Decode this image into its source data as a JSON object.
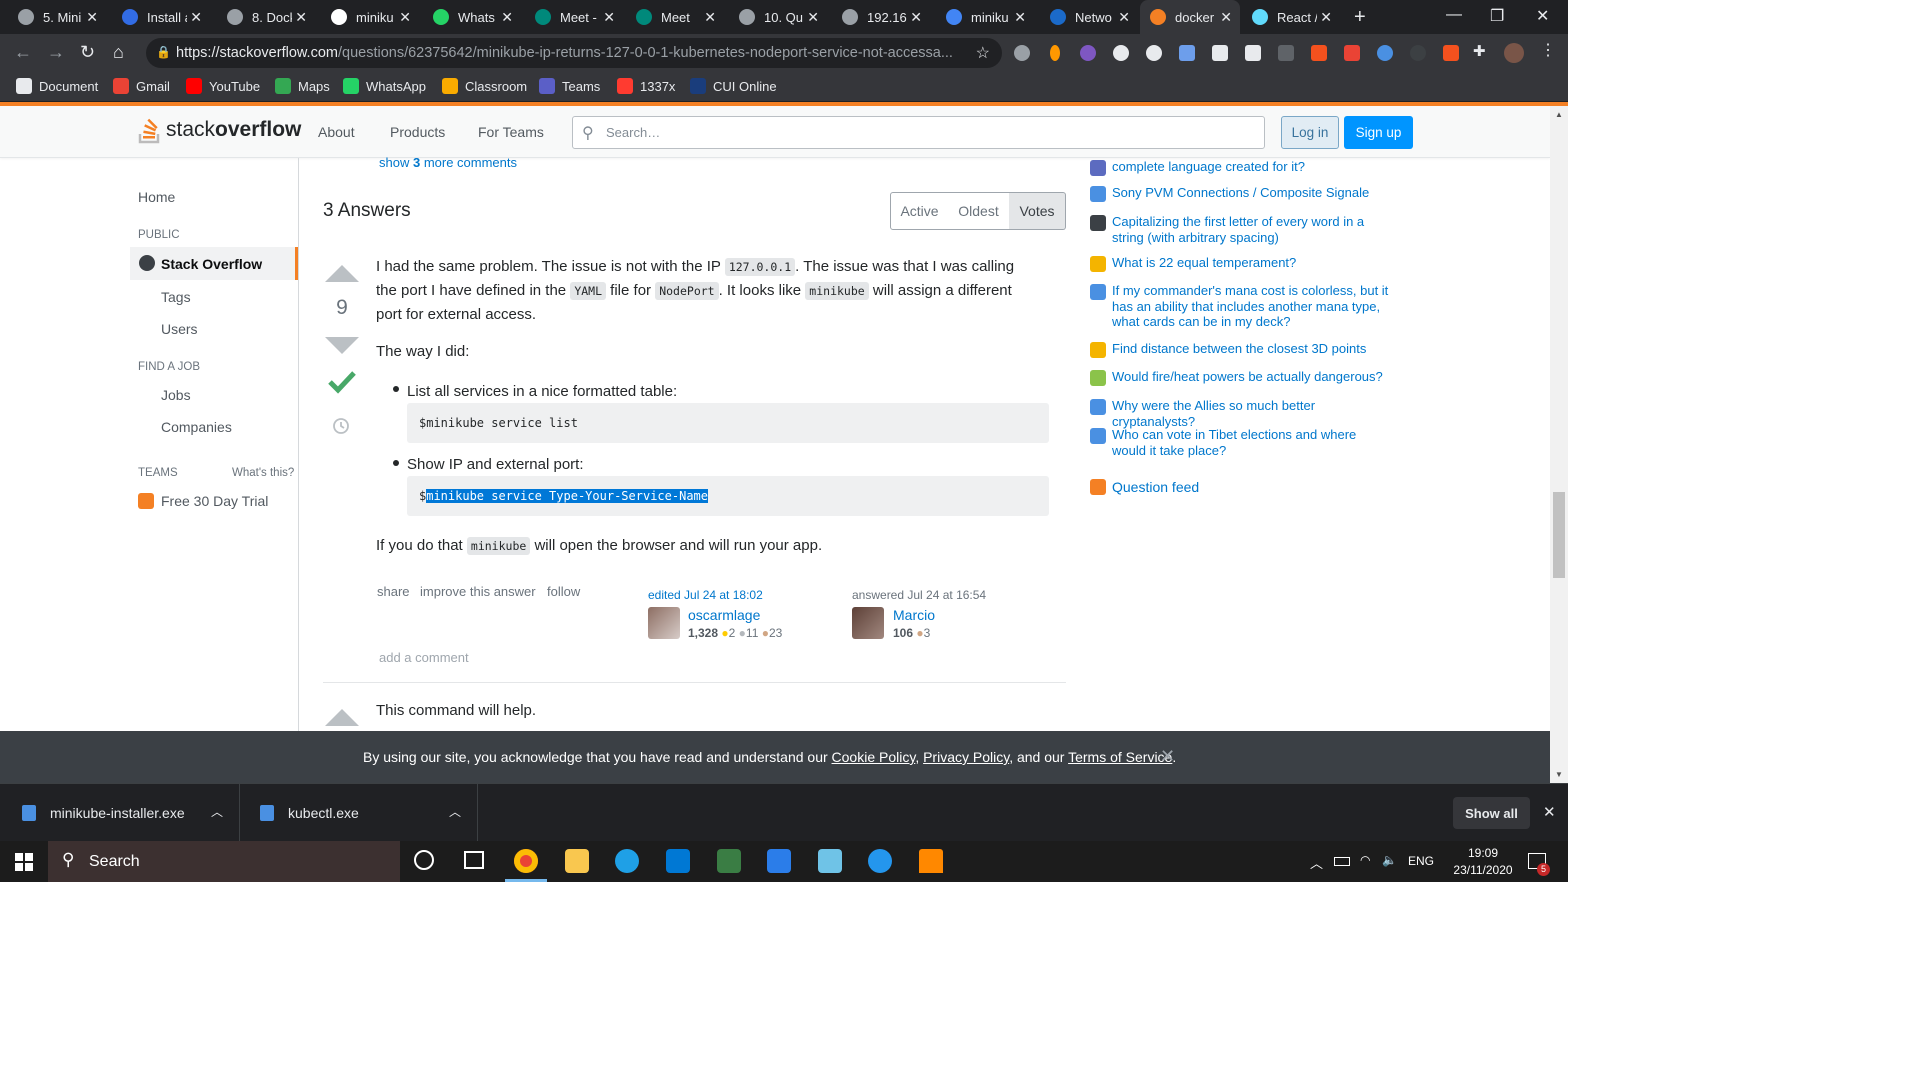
{
  "browser": {
    "tabs": [
      {
        "title": "5. Mini",
        "favicon": "#9aa0a6"
      },
      {
        "title": "Install a",
        "favicon": "#326ce5"
      },
      {
        "title": "8. Dock",
        "favicon": "#9aa0a6"
      },
      {
        "title": "miniku",
        "favicon": "#ffffff"
      },
      {
        "title": "Whats",
        "favicon": "#25d366"
      },
      {
        "title": "Meet -",
        "favicon": "#00897b"
      },
      {
        "title": "Meet",
        "favicon": "#00897b"
      },
      {
        "title": "10. Qu",
        "favicon": "#9aa0a6"
      },
      {
        "title": "192.16",
        "favicon": "#9aa0a6"
      },
      {
        "title": "miniku",
        "favicon": "#4285f4"
      },
      {
        "title": "Netwo",
        "favicon": "#1b6ac9"
      },
      {
        "title": "docker",
        "favicon": "#f48024"
      },
      {
        "title": "React /",
        "favicon": "#61dafb"
      }
    ],
    "url_host": "https://stackoverflow.com",
    "url_path": "/questions/62375642/minikube-ip-returns-127-0-0-1-kubernetes-nodeport-service-not-accessa...",
    "bookmarks": [
      {
        "label": "Document",
        "color": "#e8eaed"
      },
      {
        "label": "Gmail",
        "color": "#ea4335"
      },
      {
        "label": "YouTube",
        "color": "#ff0000"
      },
      {
        "label": "Maps",
        "color": "#34a853"
      },
      {
        "label": "WhatsApp",
        "color": "#25d366"
      },
      {
        "label": "Classroom",
        "color": "#f9ab00"
      },
      {
        "label": "Teams",
        "color": "#5b5fc7"
      },
      {
        "label": "1337x",
        "color": "#ff3b30"
      },
      {
        "label": "CUI Online",
        "color": "#1a3d7c"
      }
    ]
  },
  "so_header": {
    "logo_plain": "stack",
    "logo_bold": "overflow",
    "nav": [
      "About",
      "Products",
      "For Teams"
    ],
    "search_placeholder": "Search…",
    "login": "Log in",
    "signup": "Sign up"
  },
  "leftnav": {
    "home": "Home",
    "public": "PUBLIC",
    "stack_overflow": "Stack Overflow",
    "tags": "Tags",
    "users": "Users",
    "find_a_job": "FIND A JOB",
    "jobs": "Jobs",
    "companies": "Companies",
    "teams": "TEAMS",
    "whats_this": "What's this?",
    "free_trial": "Free 30 Day Trial"
  },
  "main": {
    "show_more_pre": "show ",
    "show_more_num": "3",
    "show_more_post": " more comments",
    "answers_heading": "3 Answers",
    "sort": [
      "Active",
      "Oldest",
      "Votes"
    ],
    "answer1": {
      "votes": "9",
      "p1_a": "I had the same problem. The issue is not with the IP ",
      "p1_code1": "127.0.0.1",
      "p1_b": ". The issue was that I was calling",
      "p1_c": "the port I have defined in the ",
      "p1_code2": "YAML",
      "p1_d": " file for ",
      "p1_code3": "NodePort",
      "p1_e": ". It looks like ",
      "p1_code4": "minikube",
      "p1_f": " will assign a different",
      "p1_g": "port for external access.",
      "p2": "The way I did:",
      "li1": "List all services in a nice formatted table:",
      "code1": "$minikube service list",
      "li2": "Show IP and external port:",
      "code2_prefix": "$",
      "code2_sel": "minikube service Type-Your-Service-Name",
      "p3_a": "If you do that ",
      "p3_code": "minikube",
      "p3_b": " will open the browser and will run your app.",
      "share": "share",
      "improve": "improve this answer",
      "follow": "follow",
      "edited": "edited Jul 24 at 18:02",
      "editor": "oscarmlage",
      "editor_rep": "1,328",
      "editor_gold": "2",
      "editor_silver": "11",
      "editor_bronze": "23",
      "answered": "answered Jul 24 at 16:54",
      "author": "Marcio",
      "author_rep": "106",
      "author_bronze": "3",
      "add_comment": "add a comment"
    },
    "answer2_first_line": "This command will help."
  },
  "hot_questions": [
    {
      "text": "complete language created for it?",
      "icon": "#5c6bc0"
    },
    {
      "text": "Sony PVM Connections / Composite Signale",
      "icon": "#4a90e2"
    },
    {
      "text": "Capitalizing the first letter of every word in a string (with arbitrary spacing)",
      "icon": "#3b4045"
    },
    {
      "text": "What is 22 equal temperament?",
      "icon": "#f4b400"
    },
    {
      "text": "If my commander's mana cost is colorless, but it has an ability that includes another mana type, what cards can be in my deck?",
      "icon": "#4a90e2"
    },
    {
      "text": "Find distance between the closest 3D points",
      "icon": "#f4b400"
    },
    {
      "text": "Would fire/heat powers be actually dangerous?",
      "icon": "#8bc34a"
    },
    {
      "text": "Why were the Allies so much better cryptanalysts?",
      "icon": "#4a90e2"
    },
    {
      "text": "Who can vote in Tibet elections and where would it take place?",
      "icon": "#4a90e2"
    }
  ],
  "question_feed": "Question feed",
  "cookie": {
    "pre": "By using our site, you acknowledge that you have read and understand our ",
    "cookie_policy": "Cookie Policy",
    "sep1": ", ",
    "privacy_policy": "Privacy Policy",
    "sep2": ", and our ",
    "terms": "Terms of Service",
    "end": "."
  },
  "downloads": {
    "items": [
      "minikube-installer.exe",
      "kubectl.exe"
    ],
    "show_all": "Show all"
  },
  "taskbar": {
    "search": "Search",
    "lang": "ENG",
    "time": "19:09",
    "date": "23/11/2020",
    "notif_count": "5"
  }
}
